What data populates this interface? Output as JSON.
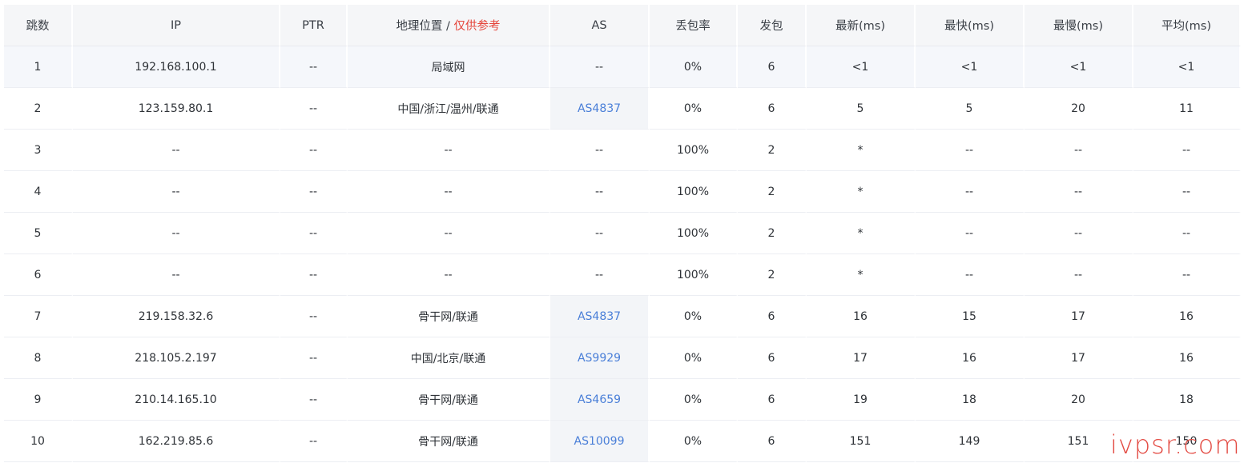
{
  "table": {
    "headers": {
      "hop": "跳数",
      "ip": "IP",
      "ptr": "PTR",
      "geo": "地理位置",
      "geo_sep": " / ",
      "geo_ref": "仅供参考",
      "as": "AS",
      "loss": "丢包率",
      "sent": "发包",
      "last": "最新(ms)",
      "best": "最快(ms)",
      "worst": "最慢(ms)",
      "avg": "平均(ms)"
    },
    "rows": [
      {
        "hop": "1",
        "ip": "192.168.100.1",
        "ptr": "--",
        "geo": "局域网",
        "as": "--",
        "loss": "0%",
        "sent": "6",
        "last": "<1",
        "best": "<1",
        "worst": "<1",
        "avg": "<1"
      },
      {
        "hop": "2",
        "ip": "123.159.80.1",
        "ptr": "--",
        "geo": "中国/浙江/温州/联通",
        "as": "AS4837",
        "loss": "0%",
        "sent": "6",
        "last": "5",
        "best": "5",
        "worst": "20",
        "avg": "11"
      },
      {
        "hop": "3",
        "ip": "--",
        "ptr": "--",
        "geo": "--",
        "as": "--",
        "loss": "100%",
        "sent": "2",
        "last": "*",
        "best": "--",
        "worst": "--",
        "avg": "--"
      },
      {
        "hop": "4",
        "ip": "--",
        "ptr": "--",
        "geo": "--",
        "as": "--",
        "loss": "100%",
        "sent": "2",
        "last": "*",
        "best": "--",
        "worst": "--",
        "avg": "--"
      },
      {
        "hop": "5",
        "ip": "--",
        "ptr": "--",
        "geo": "--",
        "as": "--",
        "loss": "100%",
        "sent": "2",
        "last": "*",
        "best": "--",
        "worst": "--",
        "avg": "--"
      },
      {
        "hop": "6",
        "ip": "--",
        "ptr": "--",
        "geo": "--",
        "as": "--",
        "loss": "100%",
        "sent": "2",
        "last": "*",
        "best": "--",
        "worst": "--",
        "avg": "--"
      },
      {
        "hop": "7",
        "ip": "219.158.32.6",
        "ptr": "--",
        "geo": "骨干网/联通",
        "as": "AS4837",
        "loss": "0%",
        "sent": "6",
        "last": "16",
        "best": "15",
        "worst": "17",
        "avg": "16"
      },
      {
        "hop": "8",
        "ip": "218.105.2.197",
        "ptr": "--",
        "geo": "中国/北京/联通",
        "as": "AS9929",
        "loss": "0%",
        "sent": "6",
        "last": "17",
        "best": "16",
        "worst": "17",
        "avg": "16"
      },
      {
        "hop": "9",
        "ip": "210.14.165.10",
        "ptr": "--",
        "geo": "骨干网/联通",
        "as": "AS4659",
        "loss": "0%",
        "sent": "6",
        "last": "19",
        "best": "18",
        "worst": "20",
        "avg": "18"
      },
      {
        "hop": "10",
        "ip": "162.219.85.6",
        "ptr": "--",
        "geo": "骨干网/联通",
        "as": "AS10099",
        "loss": "0%",
        "sent": "6",
        "last": "151",
        "best": "149",
        "worst": "151",
        "avg": "150"
      }
    ]
  },
  "watermark": "ivpsr.com",
  "colors": {
    "header_bg": "#f5f6f8",
    "as_link": "#4a7fd8",
    "geo_ref": "#e5453b",
    "watermark": "#e34b43"
  }
}
